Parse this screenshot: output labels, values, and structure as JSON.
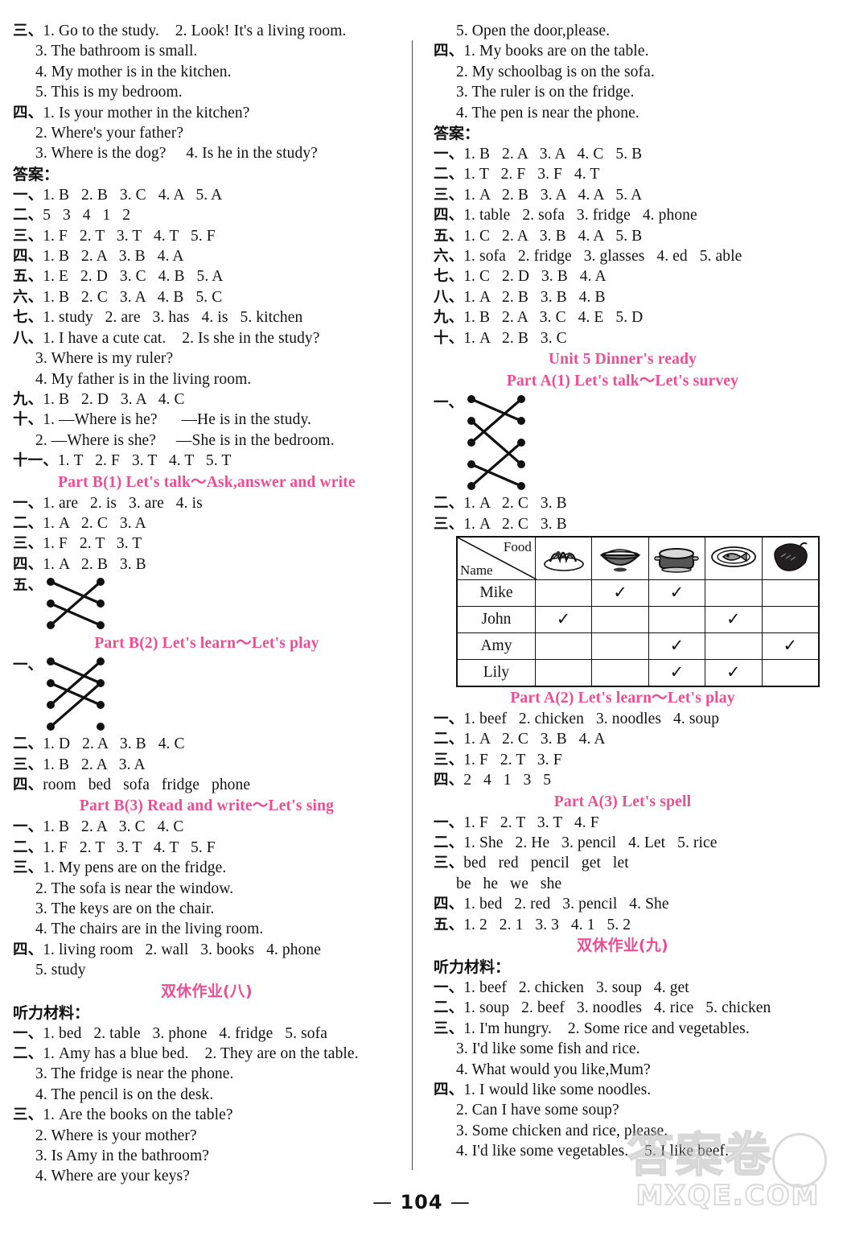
{
  "page": {
    "number": "104",
    "page_marker_left": "—",
    "page_marker_right": "—",
    "watermark_cn": "答案卷",
    "watermark_site": "MXQE.COM"
  },
  "labels": {
    "answers_header": "答案：",
    "listening_header": "听力材料：",
    "n1": "一、",
    "n2": "二、",
    "n3": "三、",
    "n4": "四、",
    "n5": "五、",
    "n6": "六、",
    "n7": "七、",
    "n8": "八、",
    "n9": "九、",
    "n10": "十、",
    "n11": "十一、"
  },
  "left_column": {
    "blocks": [
      {
        "type": "lines",
        "items": [
          {
            "label": "三、",
            "text": "1. Go to the study.    2. Look! It's a living room."
          },
          {
            "label": "",
            "text": "3. The bathroom is small."
          },
          {
            "label": "",
            "text": "4. My mother is in the kitchen."
          },
          {
            "label": "",
            "text": "5. This is my bedroom."
          },
          {
            "label": "四、",
            "text": "1. Is your mother in the kitchen?"
          },
          {
            "label": "",
            "text": "2. Where's your father?"
          },
          {
            "label": "",
            "text": "3. Where is the dog?     4. Is he in the study?"
          }
        ]
      },
      {
        "type": "answers_title",
        "text": "答案："
      },
      {
        "type": "lines",
        "items": [
          {
            "label": "一、",
            "text": "1. B   2. B   3. C   4. A   5. A"
          },
          {
            "label": "二、",
            "text": "5   3   4   1   2"
          },
          {
            "label": "三、",
            "text": "1. F   2. T   3. T   4. T   5. F"
          },
          {
            "label": "四、",
            "text": "1. B   2. A   3. B   4. A"
          },
          {
            "label": "五、",
            "text": "1. E   2. D   3. C   4. B   5. A"
          },
          {
            "label": "六、",
            "text": "1. B   2. C   3. A   4. B   5. C"
          },
          {
            "label": "七、",
            "text": "1. study   2. are   3. has   4. is   5. kitchen"
          },
          {
            "label": "八、",
            "text": "1. I have a cute cat.    2. Is she in the study?"
          },
          {
            "label": "",
            "text": "3. Where is my ruler?"
          },
          {
            "label": "",
            "text": "4. My father is in the living room."
          },
          {
            "label": "九、",
            "text": "1. B   2. D   3. A   4. C"
          },
          {
            "label": "十、",
            "text": "1. —Where is he?      —He is in the study."
          },
          {
            "label": "",
            "text": "2. —Where is she?     —She is in the bedroom."
          },
          {
            "label": "十一、",
            "text": "1. T   2. F   3. T   4. T   5. T"
          }
        ]
      },
      {
        "type": "heading",
        "text": "Part B(1)    Let's talk～Ask,answer and write"
      },
      {
        "type": "lines",
        "items": [
          {
            "label": "一、",
            "text": "1. are   2. is   3. are   4. is"
          },
          {
            "label": "二、",
            "text": "1. A   2. C   3. A"
          },
          {
            "label": "三、",
            "text": "1. F   2. T   3. T"
          },
          {
            "label": "四、",
            "text": "1. A   2. B   3. B"
          }
        ]
      },
      {
        "type": "match",
        "label": "五、",
        "rows": 3,
        "links": [
          [
            1,
            2
          ],
          [
            2,
            3
          ],
          [
            3,
            1
          ]
        ]
      },
      {
        "type": "heading",
        "text": "Part B(2)    Let's learn～Let's play"
      },
      {
        "type": "match",
        "label": "一、",
        "rows": 4,
        "links": [
          [
            1,
            2
          ],
          [
            2,
            3
          ],
          [
            3,
            1
          ],
          [
            4,
            2
          ]
        ]
      },
      {
        "type": "lines",
        "items": [
          {
            "label": "二、",
            "text": "1. D   2. A   3. B   4. C"
          },
          {
            "label": "三、",
            "text": "1. B   2. A   3. A"
          },
          {
            "label": "四、",
            "text": "room   bed   sofa   fridge   phone"
          }
        ]
      },
      {
        "type": "heading",
        "text": "Part B(3)    Read and write～Let's sing"
      },
      {
        "type": "lines",
        "items": [
          {
            "label": "一、",
            "text": "1. B   2. A   3. C   4. C"
          },
          {
            "label": "二、",
            "text": "1. F   2. T   3. T   4. T   5. F"
          },
          {
            "label": "三、",
            "text": "1. My pens are on the fridge."
          },
          {
            "label": "",
            "text": "2. The sofa is near the window."
          },
          {
            "label": "",
            "text": "3. The keys are on the chair."
          },
          {
            "label": "",
            "text": "4. The chairs are in the living room."
          },
          {
            "label": "四、",
            "text": "1. living room   2. wall   3. books   4. phone"
          },
          {
            "label": "",
            "text": "5. study"
          }
        ]
      },
      {
        "type": "heading_cn",
        "text": "双休作业(八)"
      },
      {
        "type": "listening_title",
        "text": "听力材料："
      },
      {
        "type": "lines",
        "items": [
          {
            "label": "一、",
            "text": "1. bed   2. table   3. phone   4. fridge   5. sofa"
          },
          {
            "label": "二、",
            "text": "1. Amy has a blue bed.    2. They are on the table."
          },
          {
            "label": "",
            "text": "3. The fridge is near the phone."
          },
          {
            "label": "",
            "text": "4. The pencil is on the desk."
          },
          {
            "label": "三、",
            "text": "1. Are the books on the table?"
          },
          {
            "label": "",
            "text": "2. Where is your mother?"
          },
          {
            "label": "",
            "text": "3. Is Amy in the bathroom?"
          },
          {
            "label": "",
            "text": "4. Where are your keys?"
          }
        ]
      }
    ]
  },
  "right_column": {
    "blocks": [
      {
        "type": "lines",
        "items": [
          {
            "label": "",
            "text": "5. Open the door,please."
          },
          {
            "label": "四、",
            "text": "1. My books are on the table."
          },
          {
            "label": "",
            "text": "2. My schoolbag is on the sofa."
          },
          {
            "label": "",
            "text": "3. The ruler is on the fridge."
          },
          {
            "label": "",
            "text": "4. The pen is near the phone."
          }
        ]
      },
      {
        "type": "answers_title",
        "text": "答案："
      },
      {
        "type": "lines",
        "items": [
          {
            "label": "一、",
            "text": "1. B   2. A   3. A   4. C   5. B"
          },
          {
            "label": "二、",
            "text": "1. T   2. F   3. F   4. T"
          },
          {
            "label": "三、",
            "text": "1. A   2. B   3. A   4. A   5. A"
          },
          {
            "label": "四、",
            "text": "1. table   2. sofa   3. fridge   4. phone"
          },
          {
            "label": "五、",
            "text": "1. C   2. A   3. B   4. A   5. B"
          },
          {
            "label": "六、",
            "text": "1. sofa   2. fridge   3. glasses   4. ed   5. able"
          },
          {
            "label": "七、",
            "text": "1. C   2. D   3. B   4. A"
          },
          {
            "label": "八、",
            "text": "1. A   2. B   3. B   4. B"
          },
          {
            "label": "九、",
            "text": "1. B   2. A   3. C   4. E   5. D"
          },
          {
            "label": "十、",
            "text": "1. A   2. B   3. C"
          }
        ]
      },
      {
        "type": "heading",
        "text": "Unit 5   Dinner's ready"
      },
      {
        "type": "heading",
        "text": "Part A(1)    Let's talk～Let's survey"
      },
      {
        "type": "match",
        "label": "一、",
        "rows": 5,
        "links": [
          [
            1,
            2
          ],
          [
            2,
            4
          ],
          [
            3,
            1
          ],
          [
            4,
            5
          ],
          [
            5,
            3
          ]
        ]
      },
      {
        "type": "lines",
        "items": [
          {
            "label": "二、",
            "text": "1. A   2. C   3. B"
          },
          {
            "label": "三、",
            "text": "1. A   2. C   3. B"
          }
        ]
      },
      {
        "type": "survey_table"
      },
      {
        "type": "heading",
        "text": "Part A(2)    Let's learn～Let's play"
      },
      {
        "type": "lines",
        "items": [
          {
            "label": "一、",
            "text": "1. beef   2. chicken   3. noodles   4. soup"
          },
          {
            "label": "二、",
            "text": "1. A   2. C   3. B   4. A"
          },
          {
            "label": "三、",
            "text": "1. F   2. T   3. F"
          },
          {
            "label": "四、",
            "text": "2   4   1   3   5"
          }
        ]
      },
      {
        "type": "heading",
        "text": "Part A(3)    Let's spell"
      },
      {
        "type": "lines",
        "items": [
          {
            "label": "一、",
            "text": "1. F   2. T   3. T   4. F"
          },
          {
            "label": "二、",
            "text": "1. She   2. He   3. pencil   4. Let   5. rice"
          },
          {
            "label": "三、",
            "text": "bed   red   pencil   get   let"
          },
          {
            "label": "",
            "text": "be   he   we   she"
          },
          {
            "label": "四、",
            "text": "1. bed   2. red   3. pencil   4. She"
          },
          {
            "label": "五、",
            "text": "1. 2   2. 1   3. 3   4. 1   5. 2"
          }
        ]
      },
      {
        "type": "heading_cn",
        "text": "双休作业(九)"
      },
      {
        "type": "listening_title",
        "text": "听力材料："
      },
      {
        "type": "lines",
        "items": [
          {
            "label": "一、",
            "text": "1. beef   2. chicken   3. soup   4. get"
          },
          {
            "label": "二、",
            "text": "1. soup   2. beef   3. noodles   4. rice   5. chicken"
          },
          {
            "label": "三、",
            "text": "1. I'm hungry.    2. Some rice and vegetables."
          },
          {
            "label": "",
            "text": "3. I'd like some fish and rice."
          },
          {
            "label": "",
            "text": "4. What would you like,Mum?"
          },
          {
            "label": "四、",
            "text": "1. I would like some noodles."
          },
          {
            "label": "",
            "text": "2. Can I have some soup?"
          },
          {
            "label": "",
            "text": "3. Some chicken and rice, please."
          },
          {
            "label": "",
            "text": "4. I'd like some vegetables.    5. I like beef."
          }
        ]
      }
    ]
  },
  "survey_table": {
    "corner_top": "Food",
    "corner_bottom": "Name",
    "foods": [
      "noodles-icon",
      "rice-bowl-icon",
      "soup-pot-icon",
      "fish-plate-icon",
      "beef-icon"
    ],
    "rows": [
      {
        "name": "Mike",
        "checks": [
          false,
          true,
          true,
          false,
          false
        ]
      },
      {
        "name": "John",
        "checks": [
          true,
          false,
          false,
          true,
          false
        ]
      },
      {
        "name": "Amy",
        "checks": [
          false,
          false,
          true,
          false,
          true
        ]
      },
      {
        "name": "Lily",
        "checks": [
          false,
          false,
          true,
          true,
          false
        ]
      }
    ],
    "check_glyph": "✓"
  },
  "colors": {
    "heading_pink": "#ec4d93",
    "text_black": "#121212"
  }
}
